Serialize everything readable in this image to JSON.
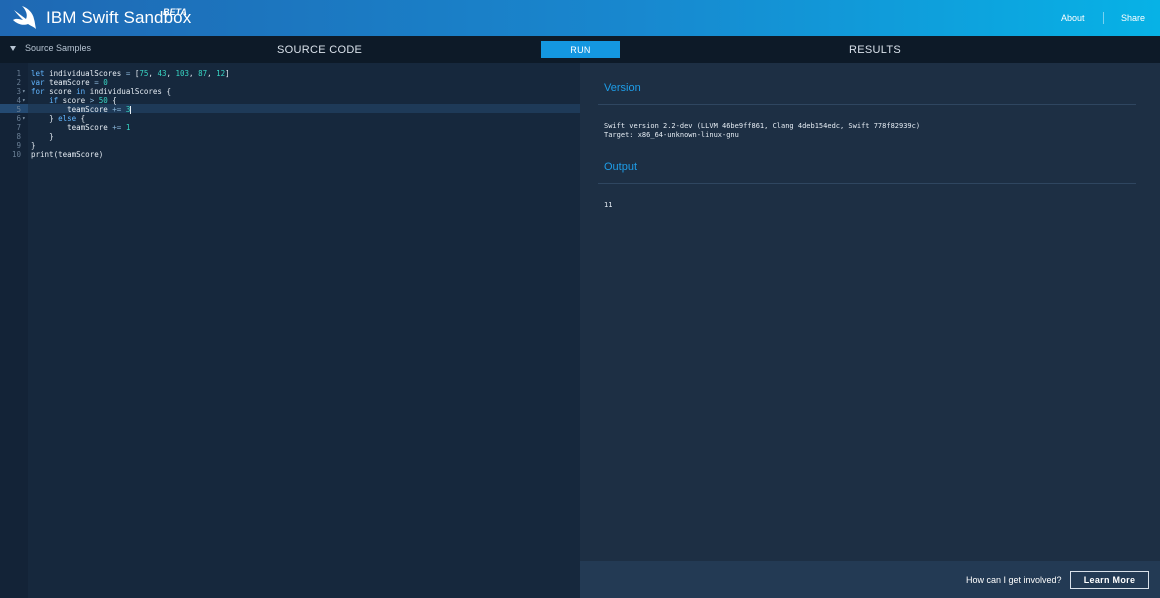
{
  "header": {
    "brand": "IBM Swift Sandbox",
    "beta": "BETA",
    "nav": {
      "about": "About",
      "share": "Share"
    }
  },
  "toolbar": {
    "samples_label": "Source Samples",
    "source_title": "SOURCE CODE",
    "run_label": "RUN",
    "results_title": "RESULTS"
  },
  "editor": {
    "active_line": 5,
    "lines": [
      {
        "n": "1",
        "fold": false,
        "text": "let individualScores = [75, 43, 103, 87, 12]"
      },
      {
        "n": "2",
        "fold": false,
        "text": "var teamScore = 0"
      },
      {
        "n": "3",
        "fold": true,
        "text": "for score in individualScores {"
      },
      {
        "n": "4",
        "fold": true,
        "text": "    if score > 50 {"
      },
      {
        "n": "5",
        "fold": false,
        "text": "        teamScore += 3"
      },
      {
        "n": "6",
        "fold": true,
        "text": "    } else {"
      },
      {
        "n": "7",
        "fold": false,
        "text": "        teamScore += 1"
      },
      {
        "n": "8",
        "fold": false,
        "text": "    }"
      },
      {
        "n": "9",
        "fold": false,
        "text": "}"
      },
      {
        "n": "10",
        "fold": false,
        "text": "print(teamScore)"
      }
    ]
  },
  "results": {
    "version_title": "Version",
    "version_line1": "Swift version 2.2-dev (LLVM 46be9ff861, Clang 4deb154edc, Swift 778f82939c)",
    "version_line2": "Target: x86_64-unknown-linux-gnu",
    "output_title": "Output",
    "output_value": "11"
  },
  "footer": {
    "involve_text": "How can I get involved?",
    "learn_more": "Learn More"
  },
  "icons": {
    "logo": "swift-bird-icon",
    "samples": "caret-down-icon",
    "fold": "fold-arrow-icon"
  },
  "colors": {
    "accent": "#1497e0",
    "header_start": "#1f68b3",
    "header_end": "#07b2e6",
    "editor_bg": "#16283d",
    "results_bg": "#1d2f44"
  }
}
